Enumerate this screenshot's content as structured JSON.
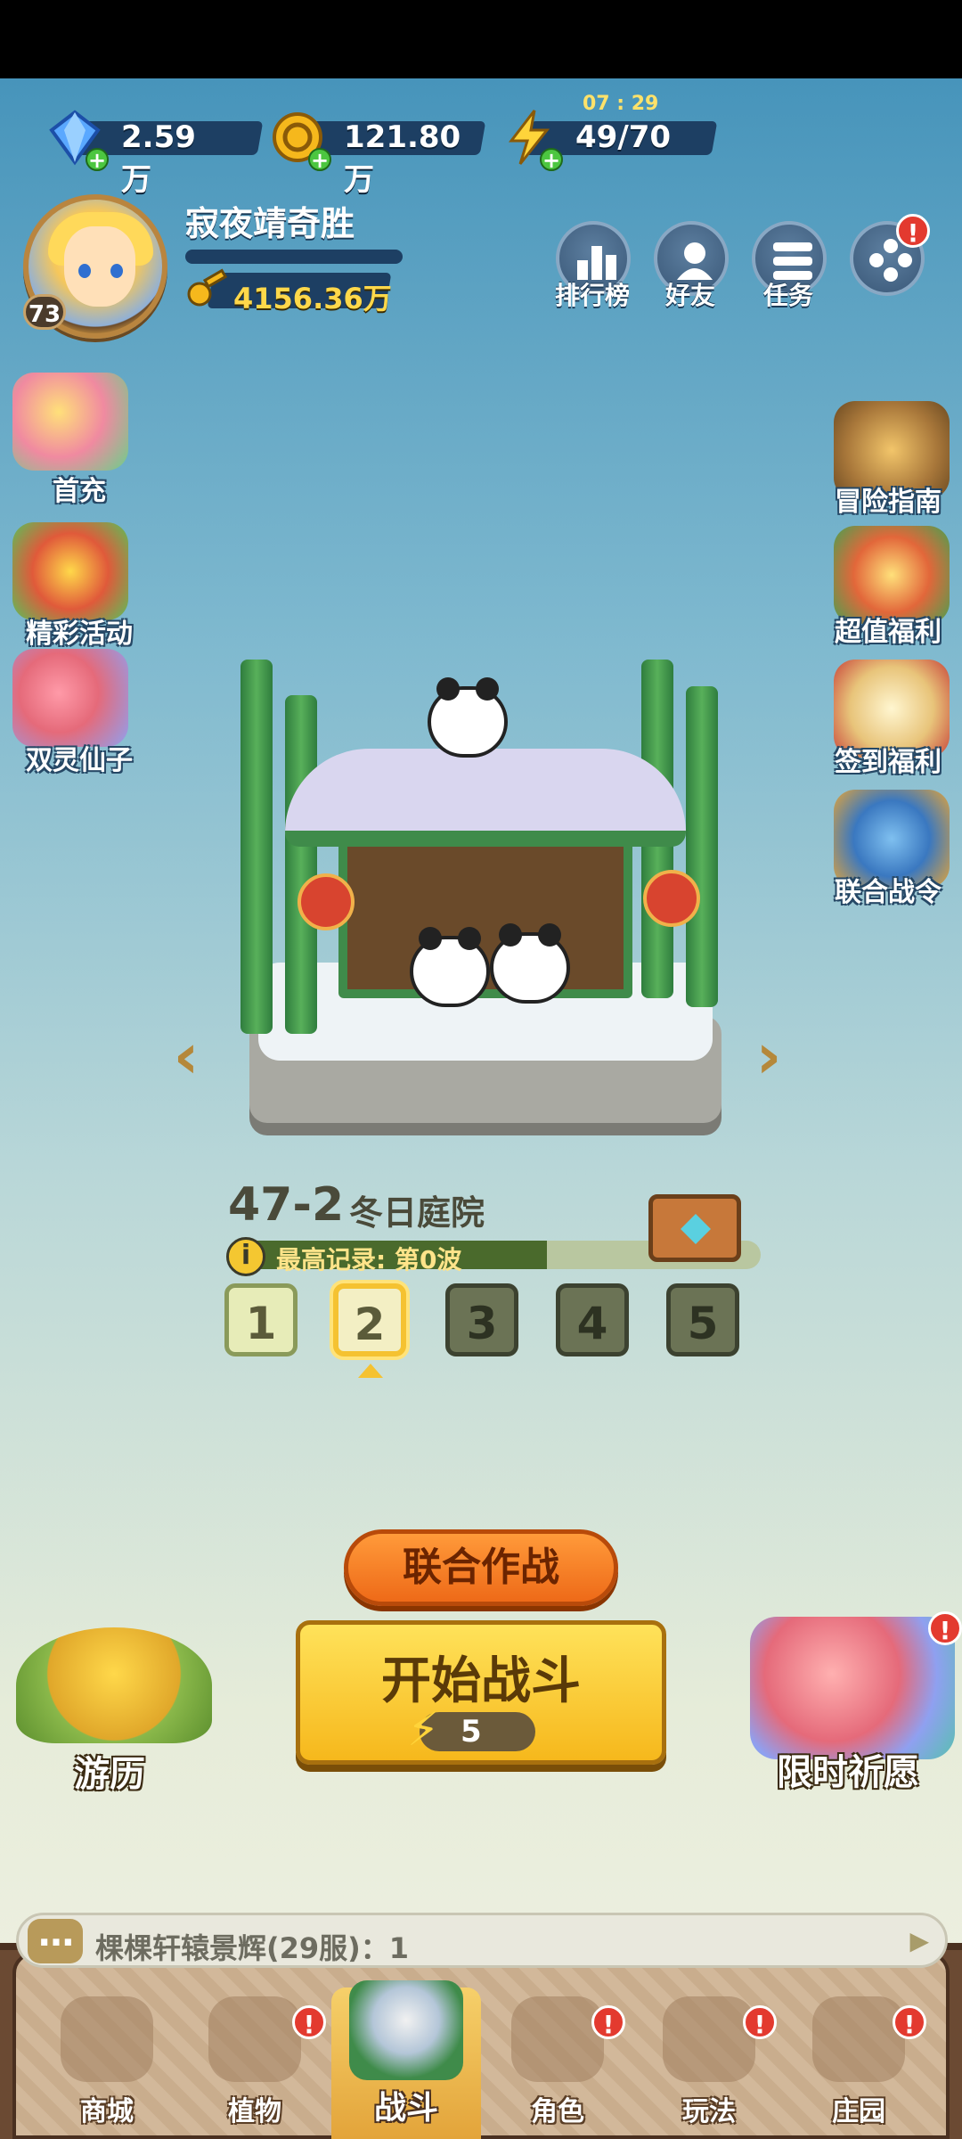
{
  "resources": {
    "gems": "2.59万",
    "coins": "121.80万",
    "energy": "49/70",
    "energy_timer": "07 : 29"
  },
  "player": {
    "name": "寂夜靖奇胜",
    "level": "73",
    "gold": "4156.36万"
  },
  "top_buttons": {
    "rank": "排行榜",
    "friends": "好友",
    "tasks": "任务"
  },
  "left_events": {
    "first_recharge": "首充",
    "events": "精彩活动",
    "twin_fairy": "双灵仙子"
  },
  "right_events": {
    "guide": "冒险指南",
    "value_welfare": "超值福利",
    "signin": "签到福利",
    "battle_pass": "联合战令"
  },
  "stage": {
    "number": "47-2",
    "name": "冬日庭院",
    "record": "最高记录: 第0波",
    "waves": [
      "1",
      "2",
      "3",
      "4",
      "5"
    ],
    "current_wave_index": 1
  },
  "actions": {
    "coop": "联合作战",
    "start": "开始战斗",
    "start_cost": "5",
    "travel": "游历",
    "wish": "限时祈愿"
  },
  "chat": {
    "prefix": "棵棵",
    "message": "轩辕景辉(29服)：1"
  },
  "nav": {
    "shop": "商城",
    "plants": "植物",
    "battle": "战斗",
    "role": "角色",
    "play": "玩法",
    "manor": "庄园"
  },
  "alert_mark": "!",
  "colors": {
    "sky_top": "#3f8fb8",
    "accent_yellow": "#f6b81c",
    "coop_orange": "#ee6a18",
    "alert_red": "#e33a2f"
  }
}
